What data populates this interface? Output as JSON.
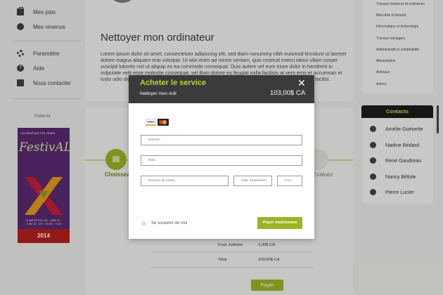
{
  "sidebar": {
    "items": [
      {
        "label": "Mes jobs",
        "icon": "briefcase-icon"
      },
      {
        "label": "Mes revenus",
        "icon": "coins-icon"
      },
      {
        "label": "Paramètre",
        "icon": "gear-icon"
      },
      {
        "label": "Aide",
        "icon": "help-icon"
      },
      {
        "label": "Nous contacter",
        "icon": "mail-icon"
      }
    ],
    "publicite": "Publicité",
    "ad": {
      "line1": "CELEBRATING TEN YEARS",
      "logo": "FestivALL",
      "small": "CHARLESTON, WV · JUNE 20 - JUNE 29 · ART · MUSIC · FILM",
      "year": "2014"
    }
  },
  "main": {
    "title": "Nettoyer mon ordinateur",
    "description": "Lorem ipsum dolor sit amet, consectetuer adipiscing elit, sed diam nonummy nibh euismod tincidunt ut laoreet dolore magna aliquam erat volutpat. Ut wisi enim ad minim veniam, quis nostrud exerci tation ullam-corper suscipit lobortis nisl ut aliquip ex ea commodo consequat. Duis autem vel eum iriure dolor in hendrerit in vulputate velit esse molestie consequat, vel illum dolore eu feugiat nulla facilisis at vero eros et accumsan et iusto odio dignissim qui blandit praesent luptatum zzril delenit augue duis dolore te feugait nulla facilisi.",
    "steps": {
      "first": "Choissez",
      "last": "Evaluez"
    },
    "summary": [
      {
        "label": "Frais Jobtobe",
        "value": "3,00$ CA"
      },
      {
        "label": "Total",
        "value": "103,00$ CA"
      }
    ],
    "pay_button": "Payer"
  },
  "right": {
    "categories": [
      "Travaux Intérieurs et extérieurs",
      "Bien-être et beauté",
      "Informatique et technologie",
      "Travaux ménagers",
      "Administratif et comptabilité",
      "Alimentation",
      "Animaux",
      "Autres"
    ],
    "contacts_title": "Contacts",
    "contacts": [
      "Amélie Guénette",
      "Nadine Bédard",
      "René Gaudreau",
      "Nancy Bélisle",
      "Pierre Lucier"
    ]
  },
  "modal": {
    "title": "Acheter le service",
    "service": "Nettoyer mon ordi",
    "price": "103,00$ CA",
    "close": "✕",
    "visa": "VISA",
    "fields": {
      "prenom": "Prénom",
      "nom": "Nom",
      "card_number": "Numéro de cartes",
      "expiry": "Date d'expiration",
      "cvv": "CVV"
    },
    "remember": "Se souvenir de moi",
    "pay_now": "Payer maintenant"
  },
  "colors": {
    "accent": "#9ab524",
    "modal_header": "#3b3b3b",
    "title_green": "#b9d234"
  }
}
